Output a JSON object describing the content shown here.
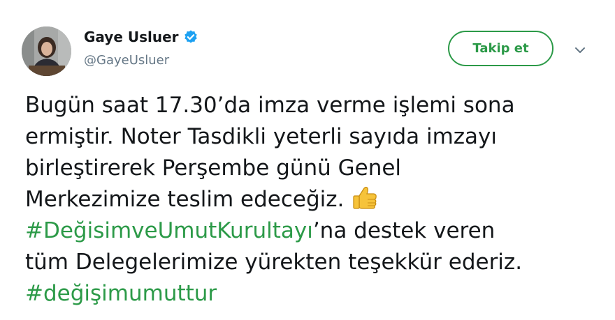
{
  "user": {
    "display_name": "Gaye Usluer",
    "handle": "@GayeUsluer",
    "verified": true,
    "avatar_icon": "profile-photo"
  },
  "actions": {
    "follow_label": "Takip et",
    "menu_icon": "chevron-down-icon"
  },
  "tweet": {
    "line1": "Bugün saat 17.30’da imza verme işlemi sona",
    "line2": "ermiştir. Noter Tasdikli yeterli sayıda imzayı",
    "line3": "birleştirerek Perşembe günü Genel",
    "line4": "Merkezimize teslim edeceğiz.",
    "emoji": "thumbs-up-icon",
    "hashtag1": "#DeğisimveUmutKurultayı",
    "line5_rest": "’na destek  veren",
    "line6": "tüm Delegelerimize yürekten teşekkür ederiz.",
    "hashtag2": "#değişimumuttur"
  },
  "colors": {
    "accent": "#2c9a48",
    "text": "#14171a",
    "secondary": "#657786",
    "verified": "#1da1f2"
  }
}
